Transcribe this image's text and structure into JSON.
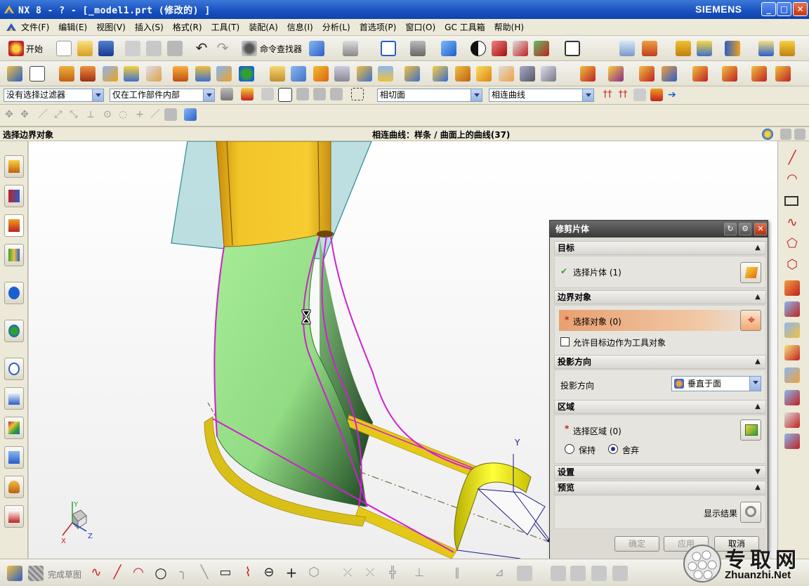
{
  "window": {
    "title": "NX 8 - ? - [_model1.prt  (修改的) ]",
    "brand": "SIEMENS",
    "min": "_",
    "max": "□",
    "close": "✕"
  },
  "menu": [
    "文件(F)",
    "编辑(E)",
    "视图(V)",
    "插入(S)",
    "格式(R)",
    "工具(T)",
    "装配(A)",
    "信息(I)",
    "分析(L)",
    "首选项(P)",
    "窗口(O)",
    "GC 工具箱",
    "帮助(H)"
  ],
  "toolbar": {
    "start_label": "开始",
    "command_finder": "命令查找器"
  },
  "selection_bar": {
    "filter": "没有选择过滤器",
    "scope": "仅在工作部件内部",
    "face_rule": "相切面",
    "curve_rule": "相连曲线"
  },
  "cue": {
    "prompt": "选择边界对象",
    "status": "相连曲线：样条 / 曲面上的曲线(37)"
  },
  "dialog": {
    "title": "修剪片体",
    "target": {
      "header": "目标",
      "select_sheet": "选择片体 (1)"
    },
    "boundary": {
      "header": "边界对象",
      "select_object": "选择对象 (0)",
      "allow_edges": "允许目标边作为工具对象",
      "allow_edges_checked": false
    },
    "projection": {
      "header": "投影方向",
      "label": "投影方向",
      "value": "垂直于面"
    },
    "region": {
      "header": "区域",
      "select_region": "选择区域 (0)",
      "keep": "保持",
      "discard": "舍弃",
      "selected": "discard"
    },
    "settings": {
      "header": "设置"
    },
    "preview": {
      "header": "预览",
      "show_result": "显示结果"
    },
    "buttons": {
      "ok": "确定",
      "apply": "应用",
      "cancel": "取消"
    },
    "required_mark": "*",
    "check_mark": "✔"
  },
  "bottom": {
    "finish_sketch": "完成草图"
  },
  "triad": {
    "x": "X",
    "y": "Y",
    "z": "Z"
  },
  "watermark": {
    "big": "专取网",
    "url": "Zhuanzhi.Net"
  },
  "colors": {
    "yellow_face": "#f0c020",
    "green_face": "#a0e890",
    "plane": "#a8d4d8",
    "curve": "#d020d0",
    "dialog_highlight": "#e8a070"
  }
}
